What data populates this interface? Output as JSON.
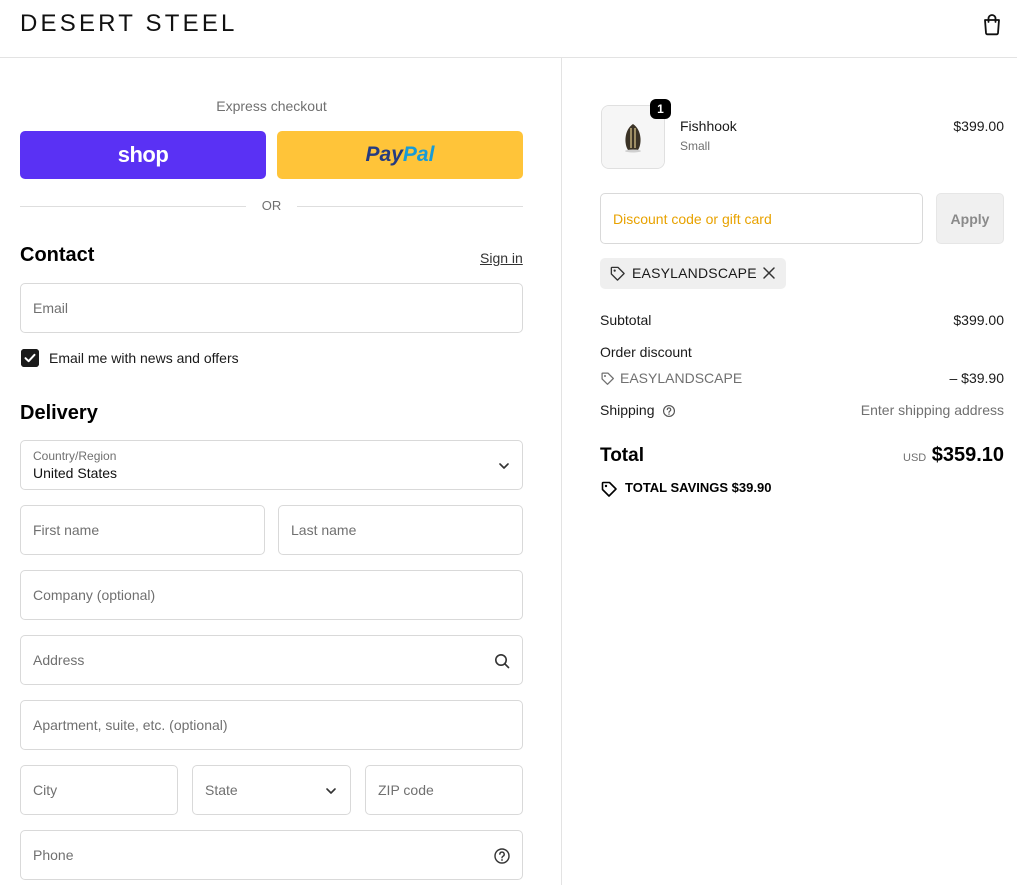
{
  "header": {
    "brand": "DESERT STEEL"
  },
  "express": {
    "title": "Express checkout",
    "shop_label": "shop",
    "paypal_a": "Pay",
    "paypal_b": "Pal",
    "or": "OR"
  },
  "contact": {
    "title": "Contact",
    "sign_in": "Sign in",
    "email_placeholder": "Email",
    "newsletter_label": "Email me with news and offers",
    "newsletter_checked": true
  },
  "delivery": {
    "title": "Delivery",
    "country_label": "Country/Region",
    "country_value": "United States",
    "first_name": "First name",
    "last_name": "Last name",
    "company": "Company (optional)",
    "address": "Address",
    "apartment": "Apartment, suite, etc. (optional)",
    "city": "City",
    "state": "State",
    "zip": "ZIP code",
    "phone": "Phone"
  },
  "summary": {
    "item": {
      "quantity": "1",
      "name": "Fishhook",
      "variant": "Small",
      "price": "$399.00"
    },
    "discount_placeholder": "Discount code or gift card",
    "apply_label": "Apply",
    "applied_code": "EASYLANDSCAPE",
    "subtotal_label": "Subtotal",
    "subtotal_value": "$399.00",
    "order_discount_label": "Order discount",
    "order_discount_code": "EASYLANDSCAPE",
    "order_discount_value": "– $39.90",
    "shipping_label": "Shipping",
    "shipping_value": "Enter shipping address",
    "total_label": "Total",
    "total_currency": "USD",
    "total_value": "$359.10",
    "savings_text": "TOTAL SAVINGS  $39.90"
  },
  "colors": {
    "shop_purple": "#5a31f4",
    "paypal_yellow": "#ffc439",
    "discount_placeholder": "#e8a200"
  }
}
